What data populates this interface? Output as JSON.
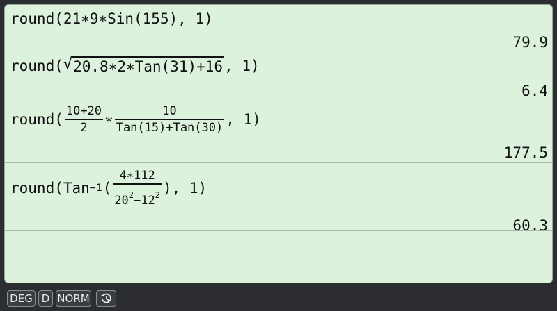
{
  "history": [
    {
      "expr_prefix": "round(21∗9∗Sin(155), 1)",
      "result": "79.9"
    },
    {
      "expr_prefix": "round(",
      "radicand": "20.8∗2∗Tan(31)+16",
      "expr_suffix": ", 1)",
      "result": "6.4"
    },
    {
      "expr_prefix": "round(",
      "frac1_num": "10+20",
      "frac1_den": "2",
      "operator": "∗",
      "frac2_num": "10",
      "frac2_den": "Tan(15)+Tan(30)",
      "expr_suffix": ", 1)",
      "result": "177.5"
    },
    {
      "expr_prefix": "round(Tan",
      "inverse": "−1",
      "open_paren": "(",
      "frac_num": "4∗112",
      "den_base1": "20",
      "den_exp1": "2",
      "den_minus": "−12",
      "den_exp2": "2",
      "expr_suffix": "), 1)",
      "result": "60.3"
    }
  ],
  "statusbar": {
    "angle_mode": "DEG",
    "format_mode": "D",
    "number_mode": "NORM",
    "history_icon": "history-icon"
  },
  "colors": {
    "screen_bg": "#dcf2dc",
    "frame_bg": "#2b2d30"
  }
}
